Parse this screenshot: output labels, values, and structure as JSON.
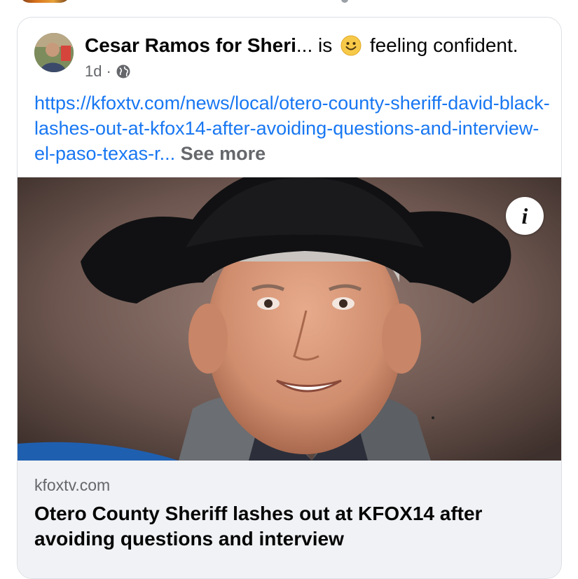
{
  "post": {
    "author": "Cesar Ramos for Sheri",
    "ellipsis": "...",
    "is_text": "is",
    "feeling": "feeling confident.",
    "emoji": "smiling-face-icon",
    "time": "1d",
    "separator": "·",
    "privacy": "globe-icon",
    "link_text": "https://kfoxtv.com/news/local/otero-county-sheriff-david-black-lashes-out-at-kfox14-after-avoiding-questions-and-interview-el-paso-texas-r...",
    "see_more": "See more"
  },
  "media": {
    "info_button": "i"
  },
  "link_preview": {
    "domain": "kfoxtv.com",
    "headline": "Otero County Sheriff lashes out at KFOX14 after avoiding questions and interview"
  },
  "colors": {
    "link": "#1877f2",
    "muted": "#65676b",
    "preview_bg": "#f0f2f5"
  }
}
